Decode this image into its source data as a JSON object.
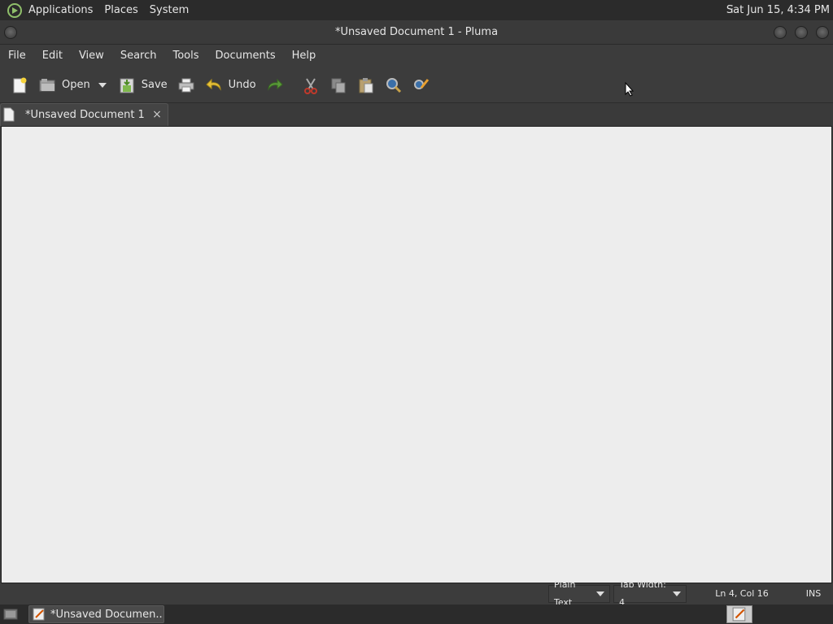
{
  "panel": {
    "menus": [
      "Applications",
      "Places",
      "System"
    ],
    "clock": "Sat Jun 15,  4:34 PM"
  },
  "window": {
    "title": "*Unsaved Document 1 - Pluma"
  },
  "menubar": [
    "File",
    "Edit",
    "View",
    "Search",
    "Tools",
    "Documents",
    "Help"
  ],
  "toolbar": {
    "new_icon": "new-document-icon",
    "open_label": "Open",
    "save_label": "Save",
    "print_icon": "printer-icon",
    "undo_label": "Undo",
    "redo_icon": "redo-icon",
    "cut_icon": "scissors-icon",
    "copy_icon": "copy-icon",
    "paste_icon": "clipboard-icon",
    "find_icon": "magnifier-icon",
    "replace_icon": "find-replace-icon"
  },
  "tab": {
    "label": "*Unsaved Document 1",
    "close": "×"
  },
  "editor": {
    "lines": []
  },
  "statusbar": {
    "language": "Plain Text",
    "tab_width": "Tab Width:  4",
    "position": "Ln 4, Col 16",
    "mode": "INS"
  },
  "taskbar": {
    "task_label": "*Unsaved Documen..."
  },
  "colors": {
    "panel": "#2b2b2b",
    "window": "#3c3c3c",
    "editor_bg": "#ededed",
    "accent_green": "#5a9a3a"
  }
}
